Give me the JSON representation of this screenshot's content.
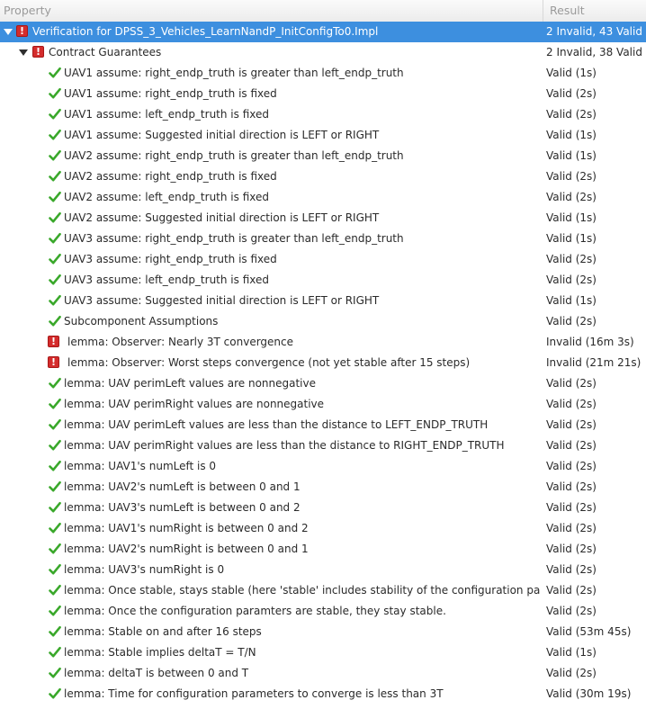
{
  "header": {
    "property": "Property",
    "result": "Result"
  },
  "rows": [
    {
      "level": 0,
      "expander": true,
      "status": "invalid",
      "selected": true,
      "label": "Verification for DPSS_3_Vehicles_LearnNandP_InitConfigTo0.Impl",
      "result": "2 Invalid, 43 Valid"
    },
    {
      "level": 1,
      "expander": true,
      "status": "invalid",
      "label": "Contract Guarantees",
      "result": "2 Invalid, 38 Valid"
    },
    {
      "level": 2,
      "status": "valid",
      "label": "UAV1 assume: right_endp_truth is greater than left_endp_truth",
      "result": "Valid (1s)"
    },
    {
      "level": 2,
      "status": "valid",
      "label": "UAV1 assume: right_endp_truth is fixed",
      "result": "Valid (2s)"
    },
    {
      "level": 2,
      "status": "valid",
      "label": "UAV1 assume: left_endp_truth is fixed",
      "result": "Valid (2s)"
    },
    {
      "level": 2,
      "status": "valid",
      "label": "UAV1 assume: Suggested initial direction is LEFT or RIGHT",
      "result": "Valid (1s)"
    },
    {
      "level": 2,
      "status": "valid",
      "label": "UAV2 assume: right_endp_truth is greater than left_endp_truth",
      "result": "Valid (1s)"
    },
    {
      "level": 2,
      "status": "valid",
      "label": "UAV2 assume: right_endp_truth is fixed",
      "result": "Valid (2s)"
    },
    {
      "level": 2,
      "status": "valid",
      "label": "UAV2 assume: left_endp_truth is fixed",
      "result": "Valid (2s)"
    },
    {
      "level": 2,
      "status": "valid",
      "label": "UAV2 assume: Suggested initial direction is LEFT or RIGHT",
      "result": "Valid (1s)"
    },
    {
      "level": 2,
      "status": "valid",
      "label": "UAV3 assume: right_endp_truth is greater than left_endp_truth",
      "result": "Valid (1s)"
    },
    {
      "level": 2,
      "status": "valid",
      "label": "UAV3 assume: right_endp_truth is fixed",
      "result": "Valid (2s)"
    },
    {
      "level": 2,
      "status": "valid",
      "label": "UAV3 assume: left_endp_truth is fixed",
      "result": "Valid (2s)"
    },
    {
      "level": 2,
      "status": "valid",
      "label": "UAV3 assume: Suggested initial direction is LEFT or RIGHT",
      "result": "Valid (1s)"
    },
    {
      "level": 2,
      "status": "valid",
      "label": "Subcomponent Assumptions",
      "result": "Valid (2s)"
    },
    {
      "level": 2,
      "status": "invalid",
      "label": "lemma: Observer: Nearly 3T convergence",
      "result": "Invalid (16m 3s)"
    },
    {
      "level": 2,
      "status": "invalid",
      "label": "lemma: Observer: Worst steps convergence (not yet stable after 15 steps)",
      "result": "Invalid (21m 21s)"
    },
    {
      "level": 2,
      "status": "valid",
      "label": "lemma: UAV perimLeft values are nonnegative",
      "result": "Valid (2s)"
    },
    {
      "level": 2,
      "status": "valid",
      "label": "lemma: UAV perimRight values are nonnegative",
      "result": "Valid (2s)"
    },
    {
      "level": 2,
      "status": "valid",
      "label": "lemma: UAV perimLeft values are less than the distance to LEFT_ENDP_TRUTH",
      "result": "Valid (2s)"
    },
    {
      "level": 2,
      "status": "valid",
      "label": "lemma: UAV perimRight values are less than the distance to RIGHT_ENDP_TRUTH",
      "result": "Valid (2s)"
    },
    {
      "level": 2,
      "status": "valid",
      "label": "lemma: UAV1's numLeft is 0",
      "result": "Valid (2s)"
    },
    {
      "level": 2,
      "status": "valid",
      "label": "lemma: UAV2's numLeft is between 0 and 1",
      "result": "Valid (2s)"
    },
    {
      "level": 2,
      "status": "valid",
      "label": "lemma: UAV3's numLeft is between 0 and 2",
      "result": "Valid (2s)"
    },
    {
      "level": 2,
      "status": "valid",
      "label": "lemma: UAV1's numRight is between 0 and 2",
      "result": "Valid (2s)"
    },
    {
      "level": 2,
      "status": "valid",
      "label": "lemma: UAV2's numRight is between 0 and 1",
      "result": "Valid (2s)"
    },
    {
      "level": 2,
      "status": "valid",
      "label": "lemma: UAV3's numRight is 0",
      "result": "Valid (2s)"
    },
    {
      "level": 2,
      "status": "valid",
      "label": "lemma: Once stable, stays stable (here 'stable' includes stability of the configuration param",
      "result": "Valid (2s)"
    },
    {
      "level": 2,
      "status": "valid",
      "label": "lemma: Once the configuration paramters are stable, they stay stable.",
      "result": "Valid (2s)"
    },
    {
      "level": 2,
      "status": "valid",
      "label": "lemma: Stable on and after 16 steps",
      "result": "Valid (53m 45s)"
    },
    {
      "level": 2,
      "status": "valid",
      "label": "lemma: Stable implies deltaT = T/N",
      "result": "Valid (1s)"
    },
    {
      "level": 2,
      "status": "valid",
      "label": "lemma: deltaT is between 0 and T",
      "result": "Valid (2s)"
    },
    {
      "level": 2,
      "status": "valid",
      "label": "lemma: Time for configuration parameters to converge is less than 3T",
      "result": "Valid (30m 19s)"
    }
  ],
  "icons": {
    "invalid": "error-icon",
    "valid": "check-icon"
  },
  "colors": {
    "selection": "#3d8fdf",
    "valid": "#3aa82b",
    "invalid": "#d42c2c"
  }
}
